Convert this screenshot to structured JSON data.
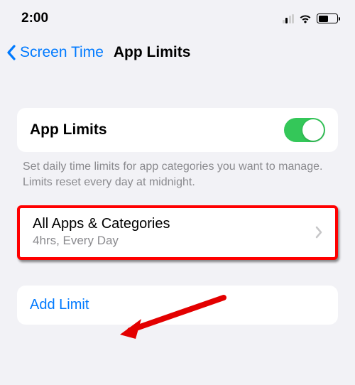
{
  "status": {
    "time": "2:00"
  },
  "nav": {
    "back_label": "Screen Time",
    "title": "App Limits"
  },
  "toggle_section": {
    "label": "App Limits",
    "footer": "Set daily time limits for app categories you want to manage. Limits reset every day at midnight."
  },
  "limit_row": {
    "title": "All Apps & Categories",
    "subtitle": "4hrs, Every Day"
  },
  "add": {
    "label": "Add Limit"
  }
}
